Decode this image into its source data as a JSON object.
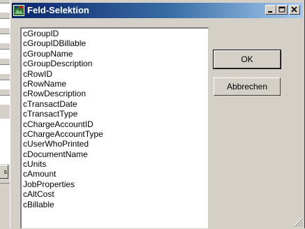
{
  "background": {
    "side_button_label": "s"
  },
  "window": {
    "title": "Feld-Selektion",
    "icon": "app-icon",
    "controls": [
      "minimize-icon",
      "maximize-icon",
      "close-icon"
    ]
  },
  "fields": [
    "cGroupID",
    "cGroupIDBillable",
    "cGroupName",
    "cGroupDescription",
    "cRowID",
    "cRowName",
    "cRowDescription",
    "cTransactDate",
    "cTransactType",
    "cChargeAccountID",
    "cChargeAccountType",
    "cUserWhoPrinted",
    "cDocumentName",
    "cUnits",
    "cAmount",
    "JobProperties",
    "cAltCost",
    "cBillable"
  ],
  "buttons": {
    "ok_label": "OK",
    "cancel_label": "Abbrechen"
  },
  "colors": {
    "titlebar_start": "#0a246a",
    "titlebar_end": "#a6caf0",
    "face": "#d4d0c8"
  }
}
